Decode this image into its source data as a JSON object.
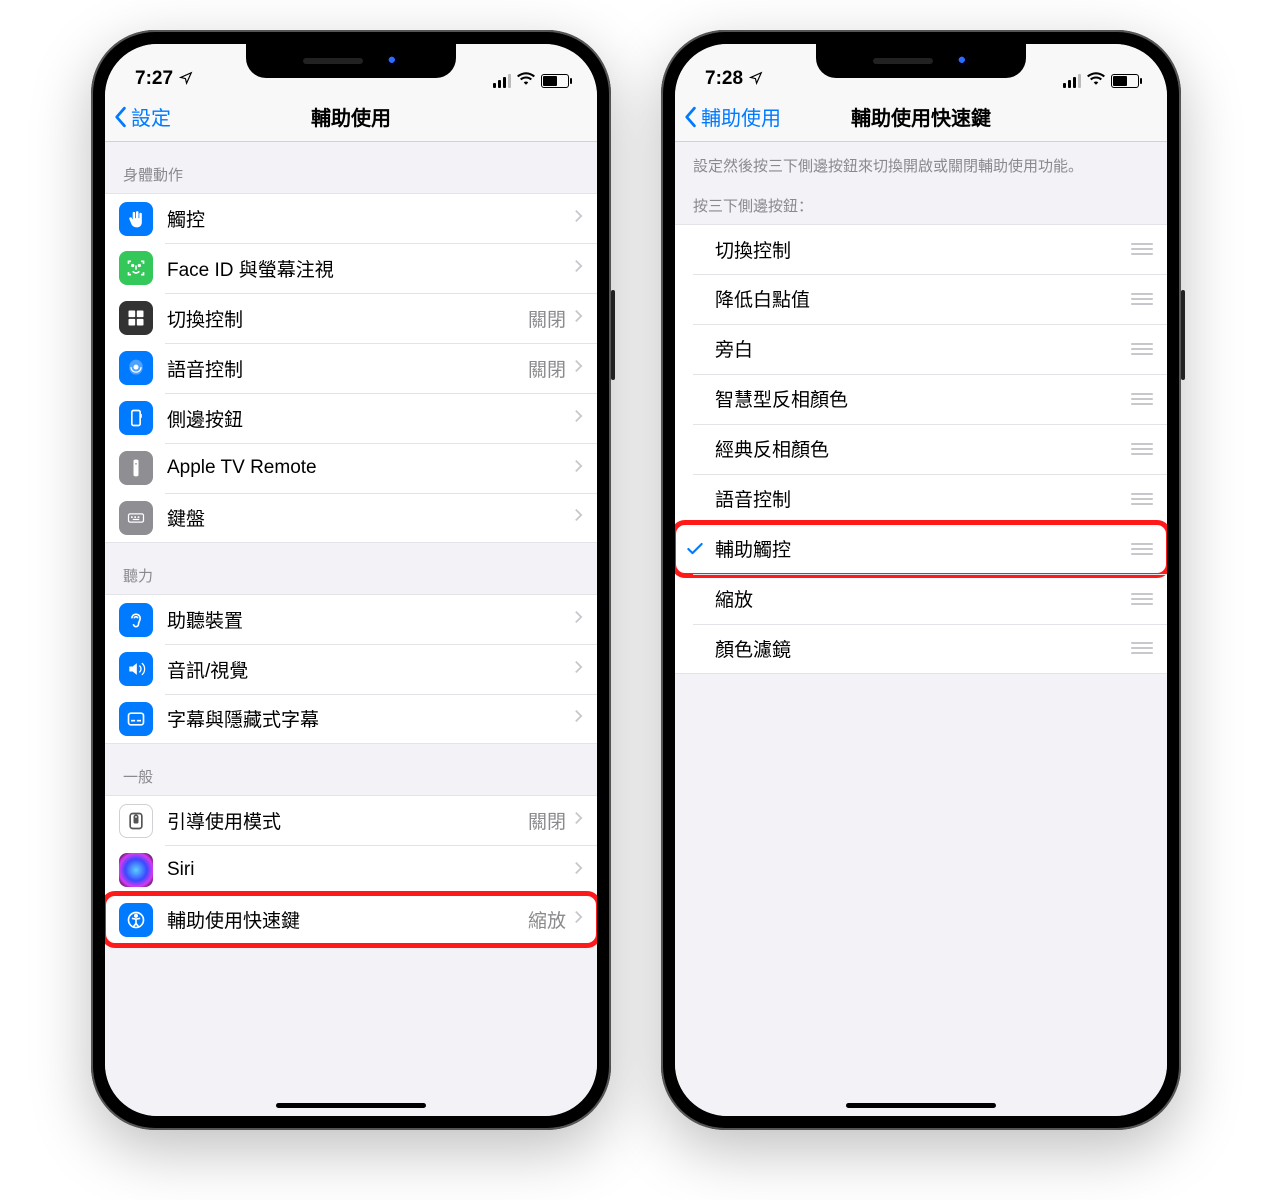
{
  "phones": {
    "left": {
      "status": {
        "time": "7:27",
        "location_arrow": "➤"
      },
      "nav": {
        "back": "設定",
        "title": "輔助使用"
      },
      "sections": [
        {
          "header": "身體動作",
          "rows": [
            {
              "icon": "hand-icon",
              "label": "觸控",
              "value": ""
            },
            {
              "icon": "face-icon",
              "label": "Face ID 與螢幕注視",
              "value": ""
            },
            {
              "icon": "switch-icon",
              "label": "切換控制",
              "value": "關閉"
            },
            {
              "icon": "voice-icon",
              "label": "語音控制",
              "value": "關閉"
            },
            {
              "icon": "sidebtn-icon",
              "label": "側邊按鈕",
              "value": ""
            },
            {
              "icon": "remote-icon",
              "label": "Apple TV Remote",
              "value": ""
            },
            {
              "icon": "keyboard-icon",
              "label": "鍵盤",
              "value": ""
            }
          ]
        },
        {
          "header": "聽力",
          "rows": [
            {
              "icon": "ear-icon",
              "label": "助聽裝置",
              "value": ""
            },
            {
              "icon": "audio-icon",
              "label": "音訊/視覺",
              "value": ""
            },
            {
              "icon": "caption-icon",
              "label": "字幕與隱藏式字幕",
              "value": ""
            }
          ]
        },
        {
          "header": "一般",
          "rows": [
            {
              "icon": "guided-icon",
              "label": "引導使用模式",
              "value": "關閉"
            },
            {
              "icon": "siri-icon",
              "label": "Siri",
              "value": ""
            },
            {
              "icon": "access-icon",
              "label": "輔助使用快速鍵",
              "value": "縮放",
              "highlight": true
            }
          ]
        }
      ]
    },
    "right": {
      "status": {
        "time": "7:28",
        "location_arrow": "➤"
      },
      "nav": {
        "back": "輔助使用",
        "title": "輔助使用快速鍵"
      },
      "description": "設定然後按三下側邊按鈕來切換開啟或關閉輔助使用功能。",
      "subheader": "按三下側邊按鈕：",
      "options": [
        {
          "label": "切換控制",
          "checked": false
        },
        {
          "label": "降低白點值",
          "checked": false
        },
        {
          "label": "旁白",
          "checked": false
        },
        {
          "label": "智慧型反相顏色",
          "checked": false
        },
        {
          "label": "經典反相顏色",
          "checked": false
        },
        {
          "label": "語音控制",
          "checked": false
        },
        {
          "label": "輔助觸控",
          "checked": true,
          "highlight": true
        },
        {
          "label": "縮放",
          "checked": false
        },
        {
          "label": "顏色濾鏡",
          "checked": false
        }
      ]
    }
  }
}
